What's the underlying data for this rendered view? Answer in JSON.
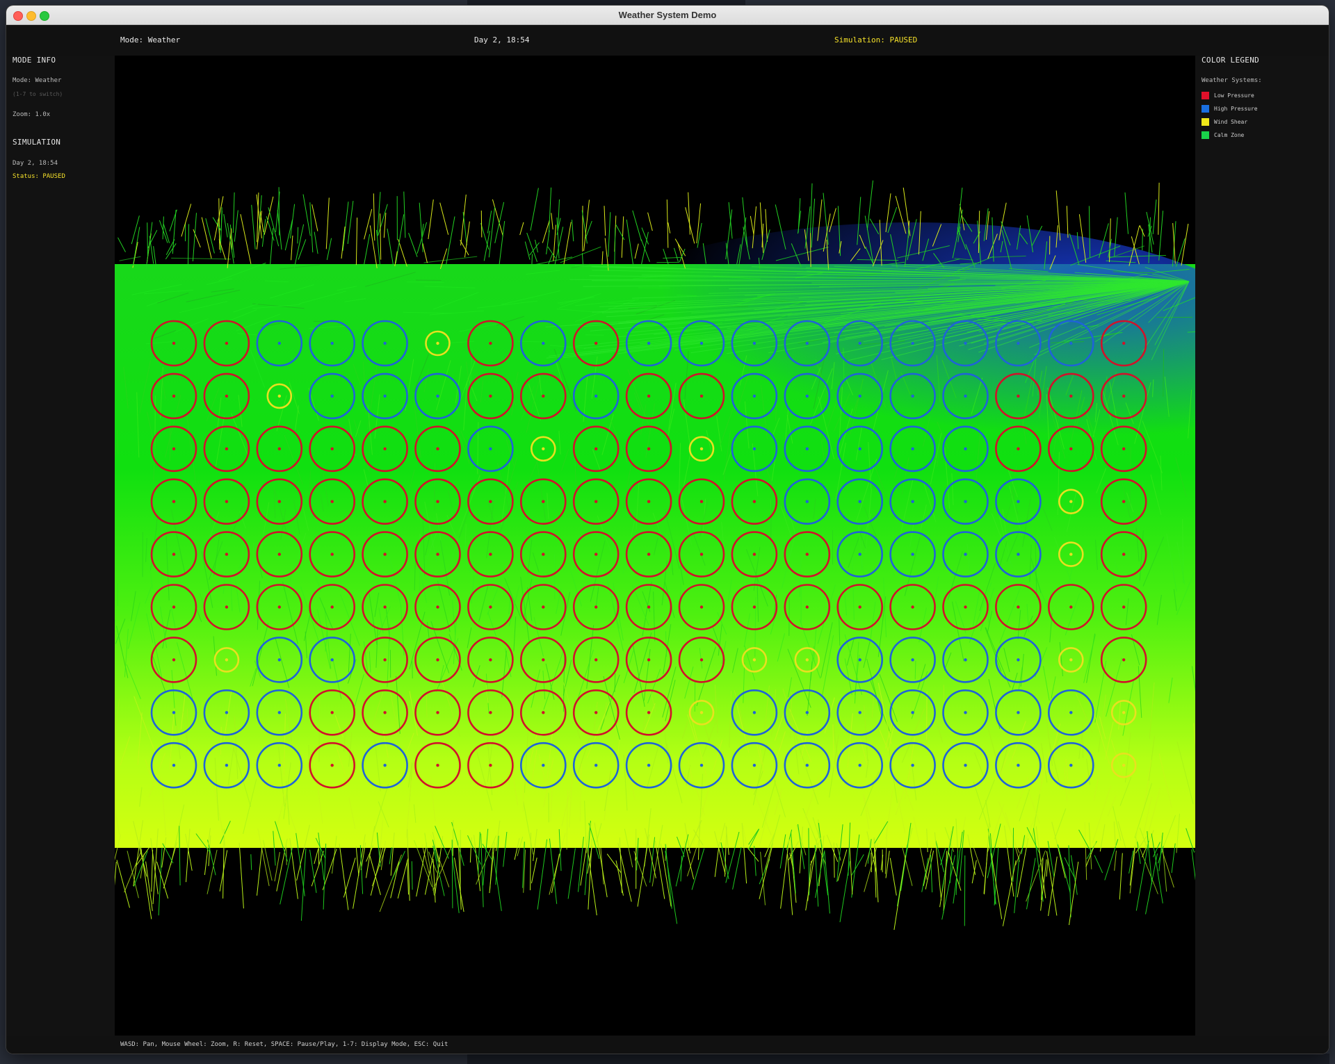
{
  "window": {
    "title": "Weather System Demo"
  },
  "topbar": {
    "mode": "Mode: Weather",
    "time": "Day 2, 18:54",
    "simulation": "Simulation: PAUSED"
  },
  "mode_info": {
    "title": "MODE INFO",
    "mode": "Mode: Weather",
    "hint": "(1-7 to switch)",
    "zoom": "Zoom: 1.0x"
  },
  "simulation": {
    "title": "SIMULATION",
    "time": "Day 2, 18:54",
    "status": "Status: PAUSED"
  },
  "legend": {
    "title": "COLOR LEGEND",
    "subtitle": "Weather Systems:",
    "items": [
      {
        "label": "Low Pressure",
        "color": "#e0102a"
      },
      {
        "label": "High Pressure",
        "color": "#1a6fe0"
      },
      {
        "label": "Wind Shear",
        "color": "#f0e81a"
      },
      {
        "label": "Calm Zone",
        "color": "#19d24a"
      }
    ]
  },
  "colors": {
    "low": "#d0122a",
    "high": "#1f63d8",
    "shear": "#e8e020",
    "calm_top": "#12dc12",
    "calm_bottom": "#c8ff12"
  },
  "grid": {
    "columns": 19,
    "rows": [
      "LLHHHSLHLHHHHHHHHHL",
      "LLSHHHLLHLLHHHHHLLL",
      "LLLLLLHSLLSHHHHHLLL",
      "LLLLLLLLLLLLHHHHHSL",
      "LLLLLLLLLLLLLHHHHSL",
      "LLLLLLLLLLLLLLLLLLL",
      "LSHHLLLLLLLSSHHHHSL",
      "HHHLLLLLLLSHHHHHHHS",
      "HHHLHLLHHHHHHHHHHHS"
    ]
  },
  "status_bar": {
    "controls": "WASD: Pan, Mouse Wheel: Zoom, R: Reset, SPACE: Pause/Play, 1-7: Display Mode, ESC: Quit"
  }
}
